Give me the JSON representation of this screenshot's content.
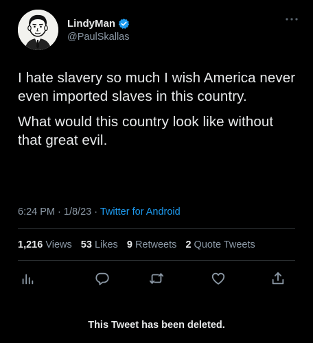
{
  "author": {
    "display_name": "LindyMan",
    "handle": "@PaulSkallas",
    "verified": true,
    "avatar": "cartoon-man-avatar"
  },
  "tweet": {
    "paragraphs": [
      "I hate slavery so much I wish America never even imported slaves in this country.",
      "What would this country look like without that great evil."
    ],
    "time": "6:24 PM",
    "date": "1/8/23",
    "source": "Twitter for Android"
  },
  "stats": {
    "views_count": "1,216",
    "views_label": "Views",
    "likes_count": "53",
    "likes_label": "Likes",
    "retweets_count": "9",
    "retweets_label": "Retweets",
    "quotes_count": "2",
    "quotes_label": "Quote Tweets"
  },
  "actions": [
    "analytics-icon",
    "reply-icon",
    "retweet-icon",
    "like-icon",
    "share-icon"
  ],
  "notice": "This Tweet has been deleted.",
  "colors": {
    "background": "#000000",
    "text": "#e7e9ea",
    "muted": "#8b98a5",
    "link": "#1d9bf0",
    "verified": "#1d9bf0",
    "divider": "#2f3336"
  }
}
